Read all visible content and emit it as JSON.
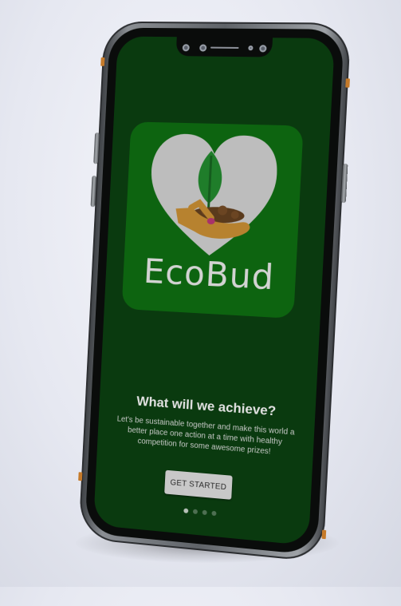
{
  "app": {
    "brand_name": "EcoBud"
  },
  "onboarding": {
    "headline": "What will we achieve?",
    "body": "Let's be sustainable together and make this world a better place one action at a time with healthy competition for some awesome prizes!",
    "cta_label": "GET STARTED",
    "page_indicator": {
      "total": 4,
      "current": 1
    }
  },
  "icons": {
    "logo": "heart-hand-sprout-icon"
  },
  "colors": {
    "screen_background": "#0a3a0f",
    "logo_tile": "#0d6410",
    "heart": "#bdbdbd",
    "leaf": "#1f7d2a",
    "hand": "#b7822f",
    "button": "#c8c8c8"
  }
}
